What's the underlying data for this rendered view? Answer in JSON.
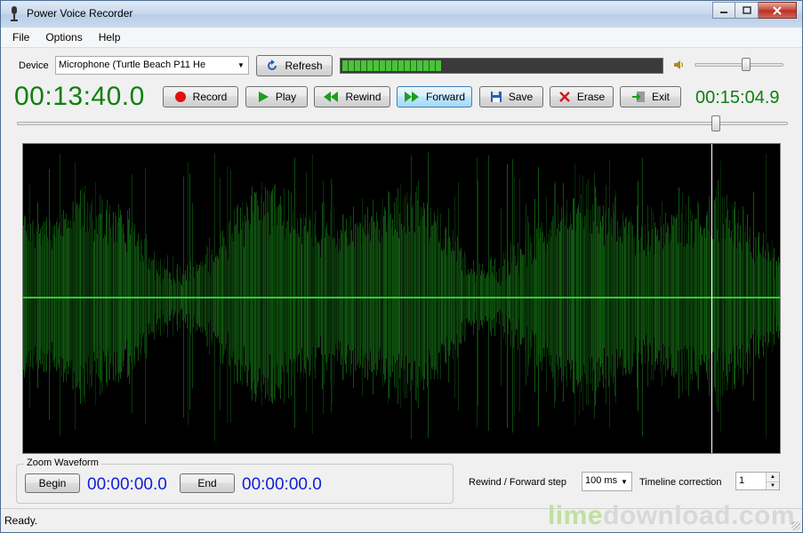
{
  "window": {
    "title": "Power Voice Recorder"
  },
  "menu": [
    "File",
    "Options",
    "Help"
  ],
  "device": {
    "label": "Device",
    "selected": "Microphone (Turtle Beach P11 He",
    "refresh_label": "Refresh"
  },
  "input_level": 0.31,
  "volume_level": 0.58,
  "time": {
    "current": "00:13:40.0",
    "total": "00:15:04.9"
  },
  "transport": {
    "record": "Record",
    "play": "Play",
    "rewind": "Rewind",
    "forward": "Forward",
    "save": "Save",
    "erase": "Erase",
    "exit": "Exit"
  },
  "position_fraction": 0.907,
  "playhead_fraction": 0.907,
  "zoom": {
    "title": "Zoom Waveform",
    "begin_label": "Begin",
    "begin_time": "00:00:00.0",
    "end_label": "End",
    "end_time": "00:00:00.0"
  },
  "step": {
    "label": "Rewind / Forward step",
    "value": "100 ms"
  },
  "timeline_correction": {
    "label": "Timeline correction",
    "value": "1"
  },
  "status": {
    "text": "Ready."
  },
  "watermark": {
    "part1": "lime",
    "part2": "download.com"
  },
  "colors": {
    "time_green": "#0e7f0e",
    "zoom_blue": "#1020d8",
    "wave_green": "#1fae1f",
    "level_green": "#4cc23a"
  },
  "icons": {
    "record": "red-circle-icon",
    "play": "green-triangle-icon",
    "rewind": "double-left-arrow-icon",
    "forward": "double-right-arrow-icon",
    "save": "floppy-disk-icon",
    "erase": "red-x-icon",
    "exit": "exit-door-icon",
    "refresh": "refresh-arrow-icon",
    "volume": "speaker-icon"
  }
}
